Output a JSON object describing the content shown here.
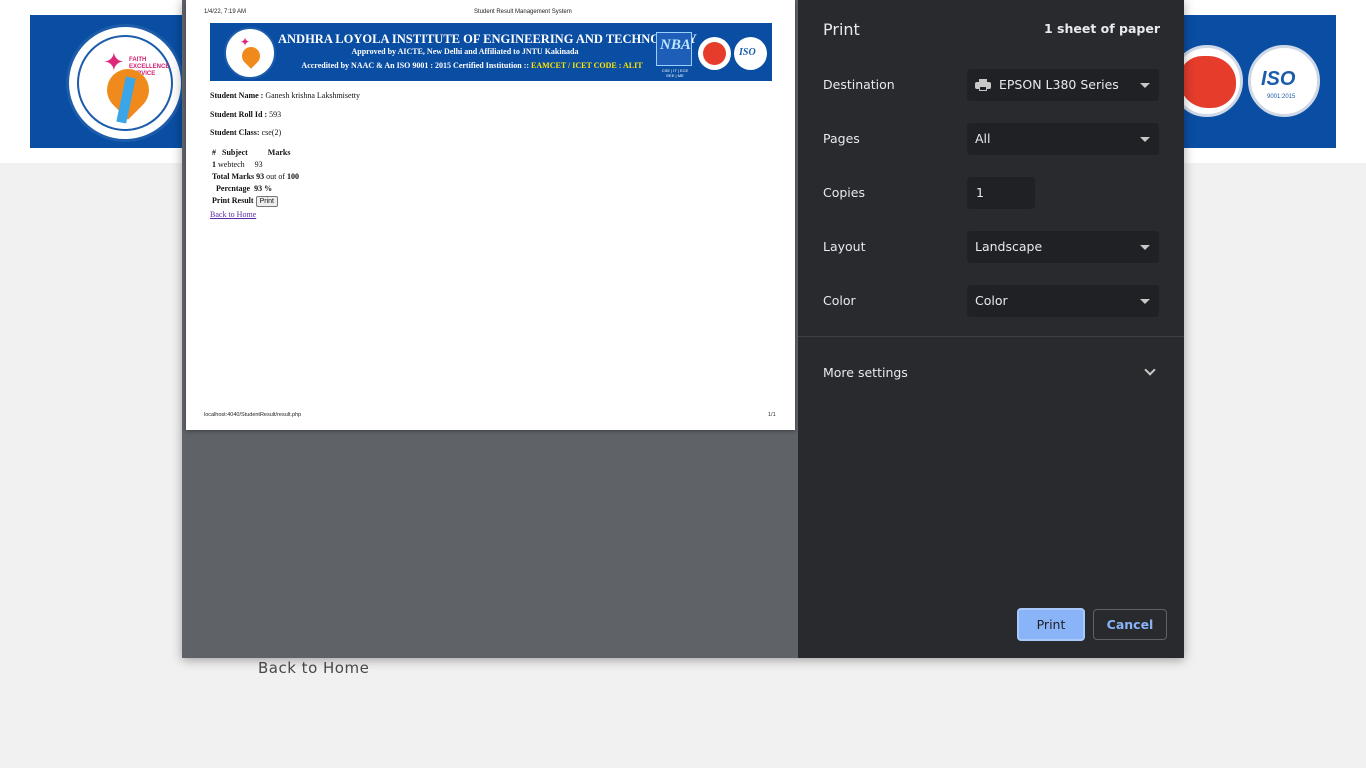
{
  "background": {
    "back_link": "Back to Home"
  },
  "paper": {
    "header_datetime": "1/4/22, 7:19 AM",
    "header_title": "Student Result Management System",
    "banner": {
      "title": "ANDHRA LOYOLA INSTITUTE OF ENGINEERING AND TECHNOLOGY",
      "approved": "Approved by AICTE, New Delhi and Affiliated to JNTU Kakinada",
      "accredited": "Accredited by NAAC & An ISO 9001 : 2015 Certified Institution :: ",
      "code": "EAMCET / ICET CODE : ALIT",
      "nba_logo": "NBA",
      "nba_text": "CSE | IT | ECE\nEEE | ME",
      "iso_logo": "ISO"
    },
    "student_name_label": "Student Name :",
    "student_name": "Ganesh krishna Lakshmisetty",
    "roll_label": "Student Roll Id :",
    "roll_id": "593",
    "class_label": "Student Class:",
    "class_value": "cse(2)",
    "table": {
      "col_hash": "#",
      "col_subject": "Subject",
      "col_marks": "Marks",
      "row_index": "1",
      "row_subject": "webtech",
      "row_marks": "93"
    },
    "total_label": "Total Marks",
    "total_value": "93",
    "out_of": "out of",
    "total_max": "100",
    "percentage_label": "Percntage",
    "percentage_value": "93 %",
    "print_result_label": "Print Result",
    "print_button": "Print",
    "back_link": "Back to Home",
    "footer_url": "localhost:4040/StudentResult/result.php",
    "footer_page": "1/1"
  },
  "settings": {
    "title": "Print",
    "sheets": "1 sheet of paper",
    "destination_label": "Destination",
    "destination_value": "EPSON L380 Series",
    "pages_label": "Pages",
    "pages_value": "All",
    "copies_label": "Copies",
    "copies_value": "1",
    "layout_label": "Layout",
    "layout_value": "Landscape",
    "color_label": "Color",
    "color_value": "Color",
    "more_settings": "More settings",
    "print_button": "Print",
    "cancel_button": "Cancel"
  },
  "colors": {
    "banner_blue": "#0a4ea3",
    "panel_bg": "#292a2d",
    "field_bg": "#202124",
    "accent": "#8ab4f8",
    "preview_bg": "#5f6368"
  }
}
